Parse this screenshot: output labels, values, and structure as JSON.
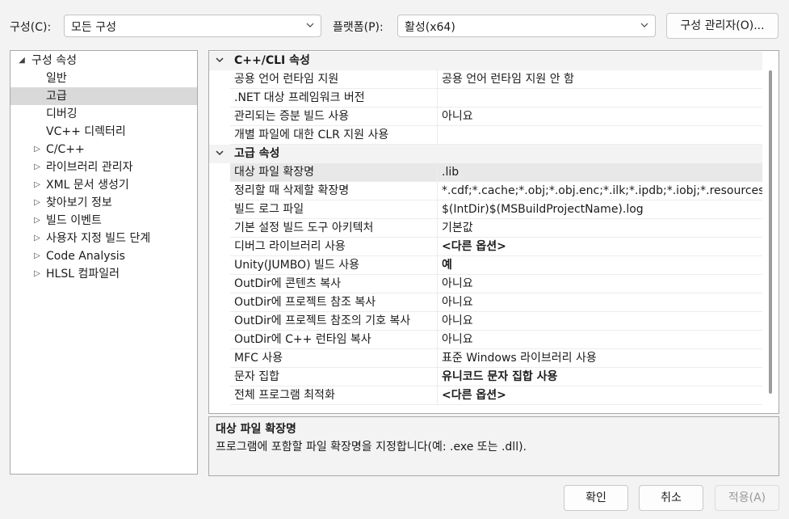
{
  "header": {
    "config_label": "구성(C):",
    "config_value": "모든 구성",
    "platform_label": "플랫폼(P):",
    "platform_value": "활성(x64)",
    "config_manager_button": "구성 관리자(O)..."
  },
  "tree": {
    "root": "구성 속성",
    "items": [
      {
        "label": "일반",
        "expandable": false
      },
      {
        "label": "고급",
        "expandable": false,
        "selected": true
      },
      {
        "label": "디버깅",
        "expandable": false
      },
      {
        "label": "VC++ 디렉터리",
        "expandable": false
      },
      {
        "label": "C/C++",
        "expandable": true
      },
      {
        "label": "라이브러리 관리자",
        "expandable": true
      },
      {
        "label": "XML 문서 생성기",
        "expandable": true
      },
      {
        "label": "찾아보기 정보",
        "expandable": true
      },
      {
        "label": "빌드 이벤트",
        "expandable": true
      },
      {
        "label": "사용자 지정 빌드 단계",
        "expandable": true
      },
      {
        "label": "Code Analysis",
        "expandable": true
      },
      {
        "label": "HLSL 컴파일러",
        "expandable": true
      }
    ]
  },
  "grid": {
    "rows": [
      {
        "category": "C++/CLI 속성"
      },
      {
        "name": "공용 언어 런타임 지원",
        "value": "공용 언어 런타임 지원 안 함"
      },
      {
        "name": ".NET 대상 프레임워크 버전",
        "value": ""
      },
      {
        "name": "관리되는 증분 빌드 사용",
        "value": "아니요"
      },
      {
        "name": "개별 파일에 대한 CLR 지원 사용",
        "value": ""
      },
      {
        "category": "고급 속성"
      },
      {
        "name": "대상 파일 확장명",
        "value": ".lib",
        "selected": true
      },
      {
        "name": "정리할 때 삭제할 확장명",
        "value": "*.cdf;*.cache;*.obj;*.obj.enc;*.ilk;*.ipdb;*.iobj;*.resources;*.tlb;*"
      },
      {
        "name": "빌드 로그 파일",
        "value": "$(IntDir)$(MSBuildProjectName).log"
      },
      {
        "name": "기본 설정 빌드 도구 아키텍처",
        "value": "기본값"
      },
      {
        "name": "디버그 라이브러리 사용",
        "value": "<다른 옵션>",
        "bold": true
      },
      {
        "name": "Unity(JUMBO) 빌드 사용",
        "value": "예",
        "bold": true
      },
      {
        "name": "OutDir에 콘텐츠 복사",
        "value": "아니요"
      },
      {
        "name": "OutDir에 프로젝트 참조 복사",
        "value": "아니요"
      },
      {
        "name": "OutDir에 프로젝트 참조의 기호 복사",
        "value": "아니요"
      },
      {
        "name": "OutDir에 C++ 런타임 복사",
        "value": "아니요"
      },
      {
        "name": "MFC 사용",
        "value": "표준 Windows 라이브러리 사용"
      },
      {
        "name": "문자 집합",
        "value": "유니코드 문자 집합 사용",
        "bold": true
      },
      {
        "name": "전체 프로그램 최적화",
        "value": "<다른 옵션>",
        "bold": true
      }
    ]
  },
  "description": {
    "title": "대상 파일 확장명",
    "text": "프로그램에 포함할 파일 확장명을 지정합니다(예: .exe 또는 .dll)."
  },
  "footer": {
    "ok": "확인",
    "cancel": "취소",
    "apply": "적용(A)"
  }
}
